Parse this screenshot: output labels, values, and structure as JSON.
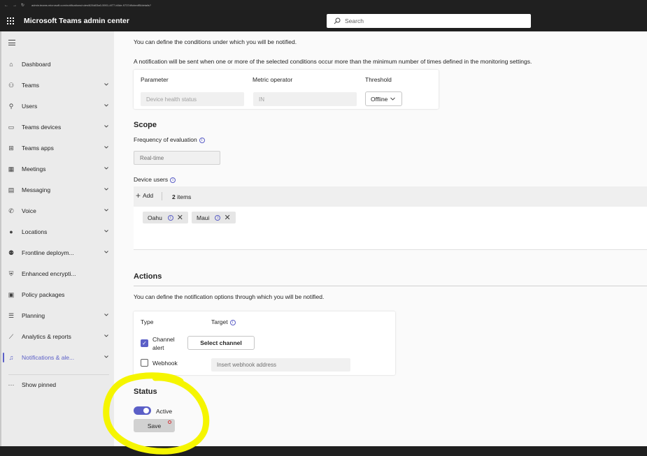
{
  "browser": {
    "url": "admin.teams.microsoft.com/notifications/rules/626d03a0-5901-4f77-b0de-9737d9cbedf5/details?"
  },
  "header": {
    "app_title": "Microsoft Teams admin center",
    "search_placeholder": "Search"
  },
  "sidebar": {
    "items": [
      {
        "label": "Dashboard",
        "icon": "home-icon"
      },
      {
        "label": "Teams",
        "icon": "teams-icon"
      },
      {
        "label": "Users",
        "icon": "users-icon"
      },
      {
        "label": "Teams devices",
        "icon": "devices-icon"
      },
      {
        "label": "Teams apps",
        "icon": "apps-icon"
      },
      {
        "label": "Meetings",
        "icon": "calendar-icon"
      },
      {
        "label": "Messaging",
        "icon": "chat-icon"
      },
      {
        "label": "Voice",
        "icon": "phone-icon"
      },
      {
        "label": "Locations",
        "icon": "globe-icon"
      },
      {
        "label": "Frontline deploym...",
        "icon": "frontline-icon"
      },
      {
        "label": "Enhanced encrypti...",
        "icon": "shield-icon"
      },
      {
        "label": "Policy packages",
        "icon": "package-icon"
      },
      {
        "label": "Planning",
        "icon": "list-icon"
      },
      {
        "label": "Analytics & reports",
        "icon": "chart-icon"
      },
      {
        "label": "Notifications & ale...",
        "icon": "bell-icon"
      }
    ],
    "show_pinned": "Show pinned"
  },
  "conditions": {
    "intro": "You can define the conditions under which you will be notified.",
    "note": "A notification will be sent when one or more of the selected conditions occur more than the minimum number of times defined in the monitoring settings.",
    "col_parameter": "Parameter",
    "col_operator": "Metric operator",
    "col_threshold": "Threshold",
    "parameter_value": "Device health status",
    "operator_value": "IN",
    "threshold_value": "Offline"
  },
  "scope": {
    "title": "Scope",
    "frequency_label": "Frequency of evaluation",
    "frequency_value": "Real-time",
    "device_users_label": "Device users",
    "add_label": "Add",
    "items_count": "2",
    "items_label": "items",
    "chips": [
      "Oahu",
      "Maui"
    ]
  },
  "actions": {
    "title": "Actions",
    "intro": "You can define the notification options through which you will be notified.",
    "col_type": "Type",
    "col_target": "Target",
    "channel_label_1": "Channel",
    "channel_label_2": "alert",
    "select_channel": "Select channel",
    "webhook_label": "Webhook",
    "webhook_placeholder": "Insert webhook address"
  },
  "status": {
    "title": "Status",
    "toggle_label": "Active",
    "save_label": "Save"
  },
  "colors": {
    "accent": "#5b5fc7",
    "annotation": "#f5f500"
  }
}
